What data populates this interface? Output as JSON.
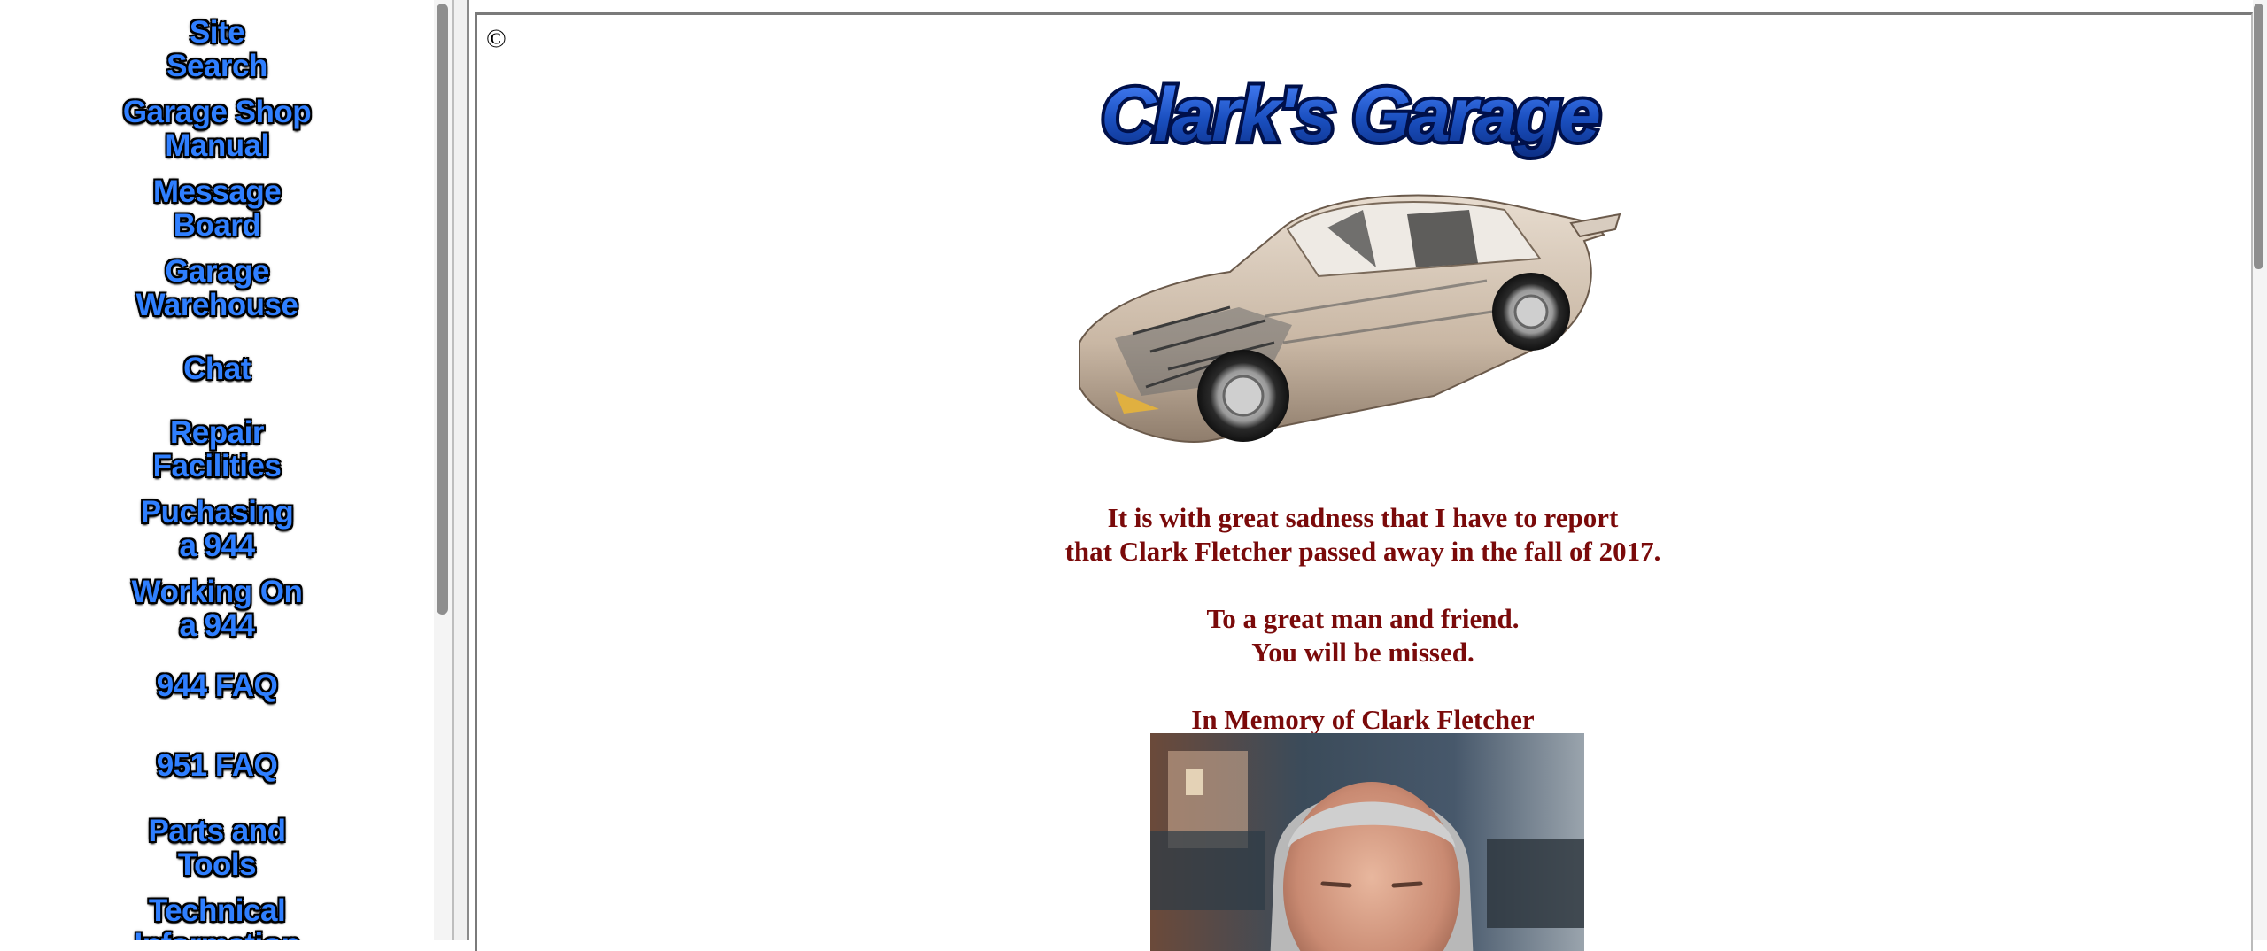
{
  "nav": {
    "items": [
      {
        "line1": "Site",
        "line2": "Search"
      },
      {
        "line1": "Garage Shop",
        "line2": "Manual"
      },
      {
        "line1": "Message",
        "line2": "Board"
      },
      {
        "line1": "Garage",
        "line2": "Warehouse"
      },
      {
        "line1": "Chat",
        "line2": ""
      },
      {
        "line1": "Repair",
        "line2": "Facilities"
      },
      {
        "line1": "Puchasing",
        "line2": "a 944"
      },
      {
        "line1": "Working On",
        "line2": "a 944"
      },
      {
        "line1": "944 FAQ",
        "line2": ""
      },
      {
        "line1": "951 FAQ",
        "line2": ""
      },
      {
        "line1": "Parts and",
        "line2": "Tools"
      },
      {
        "line1": "Technical",
        "line2": "Information"
      }
    ]
  },
  "main": {
    "copyright": "©",
    "logo_text": "Clark's Garage",
    "memorial": {
      "line1": "It is with great sadness that I have to report",
      "line2": "that Clark Fletcher passed away in the fall of 2017.",
      "line3": "To a great man and friend.",
      "line4": "You will be missed.",
      "heading": "In Memory of Clark Fletcher"
    }
  },
  "colors": {
    "nav_fill": "#2f7fff",
    "nav_outline": "#000000",
    "memorial_text": "#7a0a0a",
    "logo_fill": "#1a4fbf",
    "logo_outline": "#00104a"
  }
}
